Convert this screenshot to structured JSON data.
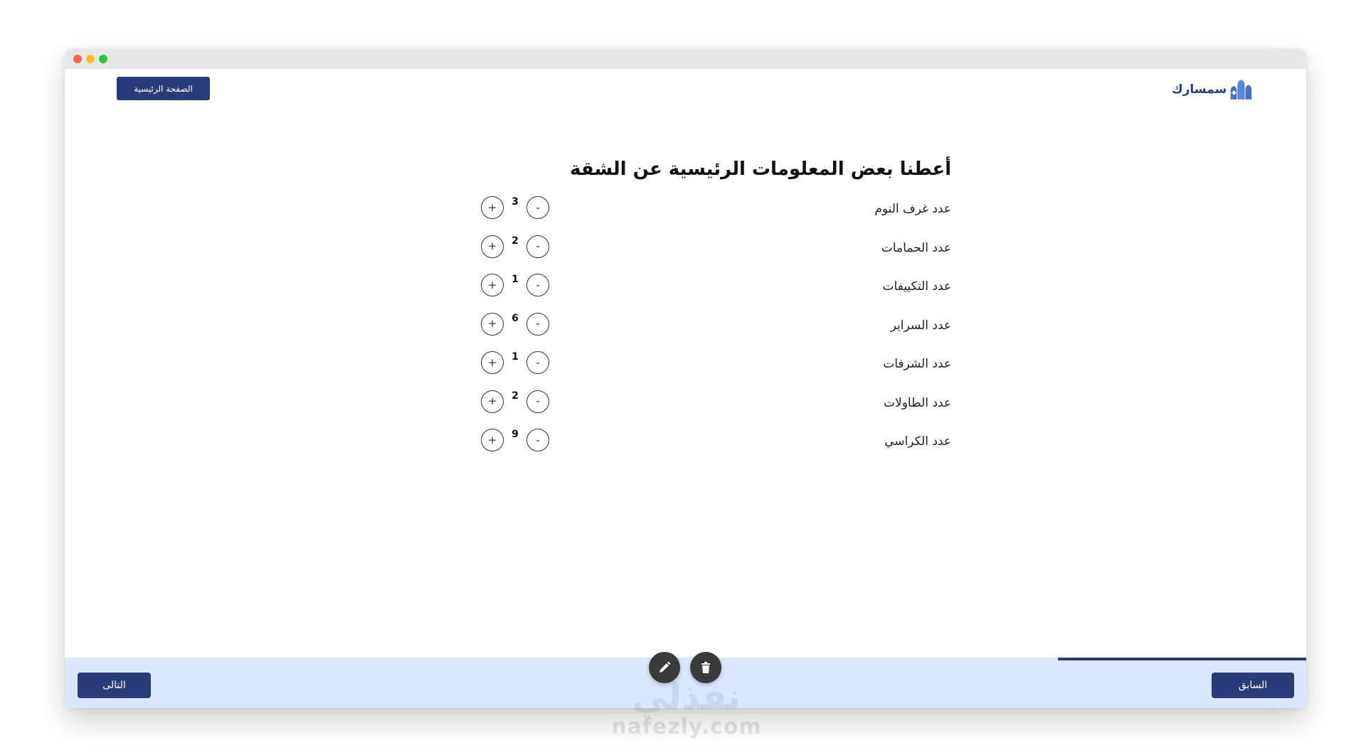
{
  "header": {
    "home_label": "الصفحة الرئيسية",
    "logo_text": "سمسارك"
  },
  "form": {
    "title": "أعطنا بعض المعلومات الرئيسية عن الشقة",
    "rows": [
      {
        "label": "عدد غرف النوم",
        "value": "3"
      },
      {
        "label": "عدد الحمامات",
        "value": "2"
      },
      {
        "label": "عدد التكييفات",
        "value": "1"
      },
      {
        "label": "عدد السراير",
        "value": "6"
      },
      {
        "label": "عدد الشرفات",
        "value": "1"
      },
      {
        "label": "عدد الطاولات",
        "value": "2"
      },
      {
        "label": "عدد الكراسي",
        "value": "9"
      }
    ],
    "plus_symbol": "+",
    "minus_symbol": "-"
  },
  "footer": {
    "next_label": "التالى",
    "prev_label": "السابق",
    "progress_fraction": 0.2
  },
  "watermark": {
    "arabic": "نفذلي",
    "latin": "nafezly.com"
  },
  "colors": {
    "primary": "#283c77",
    "footer_bg": "#dbe7fd",
    "fab_bg": "#3a3a3a"
  },
  "icons": {
    "edit": "pencil-icon",
    "delete": "trash-icon"
  }
}
